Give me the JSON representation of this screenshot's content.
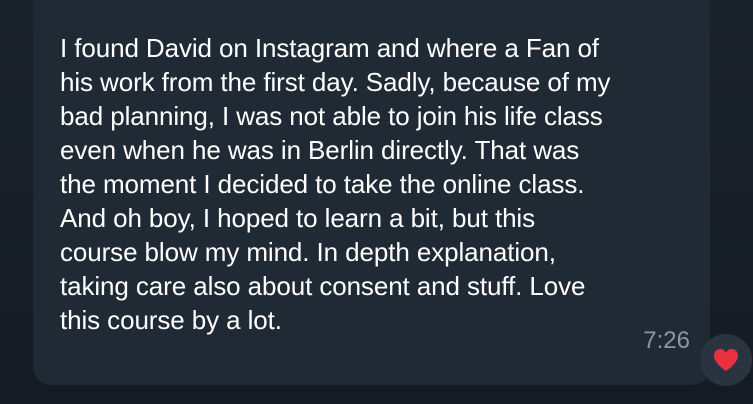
{
  "message": {
    "text": "I found David on Instagram and where a Fan of\nhis work from the first day. Sadly, because of my\nbad planning, I was not able to join his life class\neven when he was in Berlin directly. That was\nthe moment I decided to take the online class.\nAnd oh boy, I hoped to learn a bit, but this\ncourse blow my mind. In depth explanation,\ntaking care also about consent and stuff. Love\nthis course by a lot.",
    "time": "7:26",
    "reaction_icon": "heart-icon",
    "reaction_color": "#e8303f"
  },
  "colors": {
    "background": "#161d26",
    "bubble": "#1f2a35",
    "text": "#ffffff",
    "time": "#8a97a3"
  }
}
